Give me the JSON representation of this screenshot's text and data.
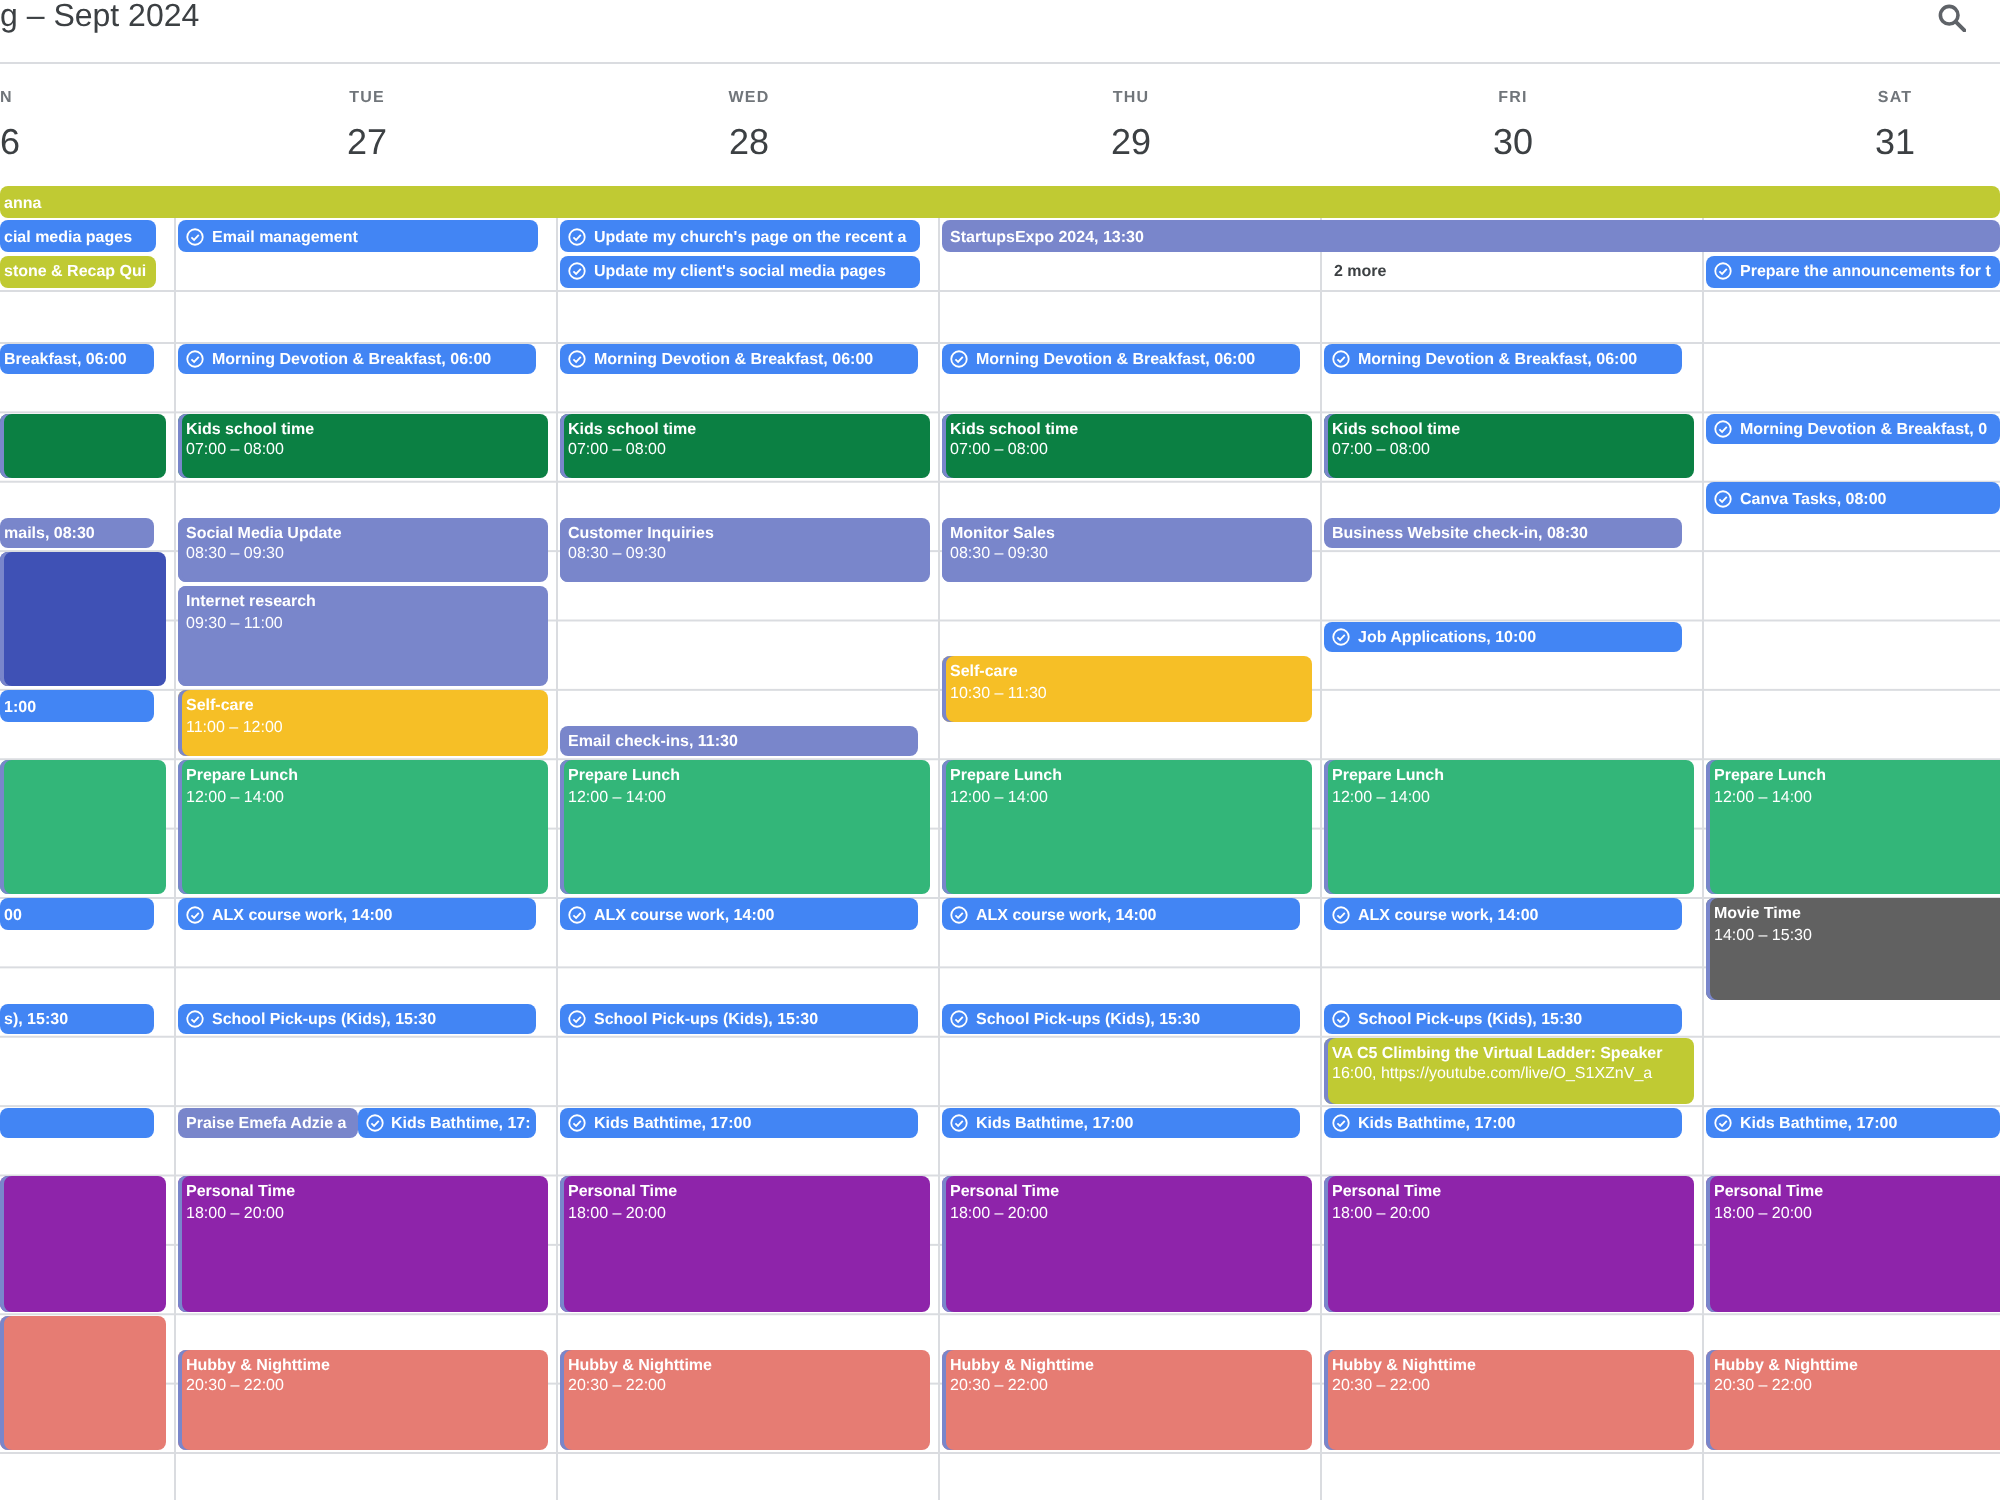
{
  "top_bar": {
    "title": "g – Sept 2024"
  },
  "day_headers": [
    {
      "name": "N",
      "date": "6"
    },
    {
      "name": "TUE",
      "date": "27"
    },
    {
      "name": "WED",
      "date": "28"
    },
    {
      "name": "THU",
      "date": "29"
    },
    {
      "name": "FRI",
      "date": "30"
    },
    {
      "name": "SAT",
      "date": "31"
    }
  ],
  "all_day_lanes": [
    [
      {
        "kind": "chip",
        "text": "anna",
        "color": "#c0ca33"
      },
      {
        "kind": "continued"
      },
      {
        "kind": "continued"
      },
      {
        "kind": "continued"
      },
      {
        "kind": "continued"
      },
      {
        "kind": "continued"
      }
    ],
    [
      {
        "kind": "chip",
        "text": "cial media pages",
        "color": "#4285f4"
      },
      {
        "kind": "task",
        "text": "Email management",
        "color": "#4285f4"
      },
      {
        "kind": "task",
        "text": "Update my church's page on the recent a",
        "color": "#4285f4"
      },
      {
        "kind": "chip",
        "text": "StartupsExpo 2024, 13:30",
        "color": "#7986cb"
      },
      {
        "kind": "continued"
      },
      {
        "kind": "continued"
      }
    ],
    [
      {
        "kind": "chip",
        "text": "stone & Recap Qui",
        "color": "#c0ca33"
      },
      {
        "kind": "empty"
      },
      {
        "kind": "task",
        "text": "Update my client's social media pages",
        "color": "#4285f4"
      },
      {
        "kind": "empty"
      },
      {
        "kind": "more",
        "text": "2 more"
      },
      {
        "kind": "task",
        "text": "Prepare the announcements for t",
        "color": "#4285f4"
      }
    ]
  ],
  "day_columns": [
    {
      "slots": [
        {
          "kind": "chip",
          "text": "Breakfast, 06:00",
          "color": "#4285f4"
        },
        {
          "kind": "empty"
        },
        {
          "kind": "block",
          "color": "#0b8043"
        },
        {
          "kind": "continued"
        },
        {
          "kind": "empty"
        },
        {
          "kind": "chip",
          "text": "mails, 08:30",
          "color": "#7986cb"
        },
        {
          "kind": "block",
          "color": "#3f51b5"
        },
        {
          "kind": "continued"
        },
        {
          "kind": "continued"
        },
        {
          "kind": "continued"
        },
        {
          "kind": "chip",
          "text": "1:00",
          "color": "#4285f4"
        },
        {
          "kind": "empty"
        },
        {
          "kind": "block",
          "color": "#33b679"
        },
        {
          "kind": "continued"
        },
        {
          "kind": "continued"
        },
        {
          "kind": "continued"
        },
        {
          "kind": "chip",
          "text": "00",
          "color": "#4285f4"
        },
        {
          "kind": "empty"
        },
        {
          "kind": "empty"
        },
        {
          "kind": "chip",
          "text": "s), 15:30",
          "color": "#4285f4"
        },
        {
          "kind": "empty"
        },
        {
          "kind": "empty"
        },
        {
          "kind": "chip",
          "color": "#4285f4"
        },
        {
          "kind": "empty"
        },
        {
          "kind": "block",
          "color": "#8e24aa"
        },
        {
          "kind": "continued"
        },
        {
          "kind": "continued"
        },
        {
          "kind": "continued"
        },
        {
          "kind": "block",
          "color": "#e67c73"
        },
        {
          "kind": "continued"
        },
        {
          "kind": "continued"
        },
        {
          "kind": "continued"
        }
      ]
    },
    {
      "slots": [
        {
          "kind": "task",
          "text": "Morning Devotion & Breakfast, 06:00",
          "color": "#4285f4"
        },
        {
          "kind": "empty"
        },
        {
          "kind": "block",
          "title": "Kids school time",
          "time": "07:00 – 08:00",
          "color": "#0b8043"
        },
        {
          "kind": "continued"
        },
        {
          "kind": "empty"
        },
        {
          "kind": "block",
          "title": "Social Media Update",
          "time": "08:30 – 09:30",
          "color": "#7986cb"
        },
        {
          "kind": "continued"
        },
        {
          "kind": "block",
          "title": "Internet research",
          "time": "09:30 – 11:00",
          "color": "#7986cb"
        },
        {
          "kind": "continued"
        },
        {
          "kind": "continued"
        },
        {
          "kind": "block",
          "title": "Self-care",
          "time": "11:00 – 12:00",
          "color": "#f6bf26"
        },
        {
          "kind": "continued"
        },
        {
          "kind": "block",
          "title": "Prepare Lunch",
          "time": "12:00 – 14:00",
          "color": "#33b679"
        },
        {
          "kind": "continued"
        },
        {
          "kind": "continued"
        },
        {
          "kind": "continued"
        },
        {
          "kind": "task",
          "text": "ALX course work, 14:00",
          "color": "#4285f4"
        },
        {
          "kind": "empty"
        },
        {
          "kind": "empty"
        },
        {
          "kind": "task",
          "text": "School Pick-ups (Kids), 15:30",
          "color": "#4285f4"
        },
        {
          "kind": "empty"
        },
        {
          "kind": "empty"
        },
        {
          "kind": "overlap",
          "events": [
            {
              "kind": "chip",
              "text": "Praise Emefa Adzie a",
              "color": "#7986cb"
            },
            {
              "kind": "task",
              "text": "Kids Bathtime, 17:",
              "color": "#4285f4"
            }
          ]
        },
        {
          "kind": "empty"
        },
        {
          "kind": "block",
          "title": "Personal Time",
          "time": "18:00 – 20:00",
          "color": "#8e24aa"
        },
        {
          "kind": "continued"
        },
        {
          "kind": "continued"
        },
        {
          "kind": "continued"
        },
        {
          "kind": "empty"
        },
        {
          "kind": "block",
          "title": "Hubby & Nighttime",
          "time": "20:30 – 22:00",
          "color": "#e67c73"
        },
        {
          "kind": "continued"
        },
        {
          "kind": "continued"
        }
      ]
    },
    {
      "slots": [
        {
          "kind": "task",
          "text": "Morning Devotion & Breakfast, 06:00",
          "color": "#4285f4"
        },
        {
          "kind": "empty"
        },
        {
          "kind": "block",
          "title": "Kids school time",
          "time": "07:00 – 08:00",
          "color": "#0b8043"
        },
        {
          "kind": "continued"
        },
        {
          "kind": "empty"
        },
        {
          "kind": "block",
          "title": "Customer Inquiries",
          "time": "08:30 – 09:30",
          "color": "#7986cb"
        },
        {
          "kind": "continued"
        },
        {
          "kind": "empty"
        },
        {
          "kind": "empty"
        },
        {
          "kind": "empty"
        },
        {
          "kind": "empty"
        },
        {
          "kind": "chip",
          "text": "Email check-ins, 11:30",
          "color": "#7986cb"
        },
        {
          "kind": "block",
          "title": "Prepare Lunch",
          "time": "12:00 – 14:00",
          "color": "#33b679"
        },
        {
          "kind": "continued"
        },
        {
          "kind": "continued"
        },
        {
          "kind": "continued"
        },
        {
          "kind": "task",
          "text": "ALX course work, 14:00",
          "color": "#4285f4"
        },
        {
          "kind": "empty"
        },
        {
          "kind": "empty"
        },
        {
          "kind": "task",
          "text": "School Pick-ups (Kids), 15:30",
          "color": "#4285f4"
        },
        {
          "kind": "empty"
        },
        {
          "kind": "empty"
        },
        {
          "kind": "task",
          "text": "Kids Bathtime, 17:00",
          "color": "#4285f4"
        },
        {
          "kind": "empty"
        },
        {
          "kind": "block",
          "title": "Personal Time",
          "time": "18:00 – 20:00",
          "color": "#8e24aa"
        },
        {
          "kind": "continued"
        },
        {
          "kind": "continued"
        },
        {
          "kind": "continued"
        },
        {
          "kind": "empty"
        },
        {
          "kind": "block",
          "title": "Hubby & Nighttime",
          "time": "20:30 – 22:00",
          "color": "#e67c73"
        },
        {
          "kind": "continued"
        },
        {
          "kind": "continued"
        }
      ]
    },
    {
      "slots": [
        {
          "kind": "task",
          "text": "Morning Devotion & Breakfast, 06:00",
          "color": "#4285f4"
        },
        {
          "kind": "empty"
        },
        {
          "kind": "block",
          "title": "Kids school time",
          "time": "07:00 – 08:00",
          "color": "#0b8043"
        },
        {
          "kind": "continued"
        },
        {
          "kind": "empty"
        },
        {
          "kind": "block",
          "title": "Monitor Sales",
          "time": "08:30 – 09:30",
          "color": "#7986cb"
        },
        {
          "kind": "continued"
        },
        {
          "kind": "empty"
        },
        {
          "kind": "empty"
        },
        {
          "kind": "block",
          "title": "Self-care",
          "time": "10:30 – 11:30",
          "color": "#f6bf26"
        },
        {
          "kind": "continued"
        },
        {
          "kind": "empty"
        },
        {
          "kind": "block",
          "title": "Prepare Lunch",
          "time": "12:00 – 14:00",
          "color": "#33b679"
        },
        {
          "kind": "continued"
        },
        {
          "kind": "continued"
        },
        {
          "kind": "continued"
        },
        {
          "kind": "task",
          "text": "ALX course work, 14:00",
          "color": "#4285f4"
        },
        {
          "kind": "empty"
        },
        {
          "kind": "empty"
        },
        {
          "kind": "task",
          "text": "School Pick-ups (Kids), 15:30",
          "color": "#4285f4"
        },
        {
          "kind": "empty"
        },
        {
          "kind": "empty"
        },
        {
          "kind": "task",
          "text": "Kids Bathtime, 17:00",
          "color": "#4285f4"
        },
        {
          "kind": "empty"
        },
        {
          "kind": "block",
          "title": "Personal Time",
          "time": "18:00 – 20:00",
          "color": "#8e24aa"
        },
        {
          "kind": "continued"
        },
        {
          "kind": "continued"
        },
        {
          "kind": "continued"
        },
        {
          "kind": "empty"
        },
        {
          "kind": "block",
          "title": "Hubby & Nighttime",
          "time": "20:30 – 22:00",
          "color": "#e67c73"
        },
        {
          "kind": "continued"
        },
        {
          "kind": "continued"
        }
      ]
    },
    {
      "slots": [
        {
          "kind": "task",
          "text": "Morning Devotion & Breakfast, 06:00",
          "color": "#4285f4"
        },
        {
          "kind": "empty"
        },
        {
          "kind": "block",
          "title": "Kids school time",
          "time": "07:00 – 08:00",
          "color": "#0b8043"
        },
        {
          "kind": "continued"
        },
        {
          "kind": "empty"
        },
        {
          "kind": "chip",
          "text": "Business Website check-in, 08:30",
          "color": "#7986cb"
        },
        {
          "kind": "empty"
        },
        {
          "kind": "empty"
        },
        {
          "kind": "task",
          "text": "Job Applications, 10:00",
          "color": "#4285f4"
        },
        {
          "kind": "empty"
        },
        {
          "kind": "empty"
        },
        {
          "kind": "empty"
        },
        {
          "kind": "block",
          "title": "Prepare Lunch",
          "time": "12:00 – 14:00",
          "color": "#33b679"
        },
        {
          "kind": "continued"
        },
        {
          "kind": "continued"
        },
        {
          "kind": "continued"
        },
        {
          "kind": "task",
          "text": "ALX course work, 14:00",
          "color": "#4285f4"
        },
        {
          "kind": "empty"
        },
        {
          "kind": "empty"
        },
        {
          "kind": "task",
          "text": "School Pick-ups (Kids), 15:30",
          "color": "#4285f4"
        },
        {
          "kind": "block",
          "title": "VA C5 Climbing the Virtual Ladder: Speaker",
          "time": "16:00, https://youtube.com/live/O_S1XZnV_a",
          "color": "#c0ca33"
        },
        {
          "kind": "continued"
        },
        {
          "kind": "task",
          "text": "Kids Bathtime, 17:00",
          "color": "#4285f4"
        },
        {
          "kind": "empty"
        },
        {
          "kind": "block",
          "title": "Personal Time",
          "time": "18:00 – 20:00",
          "color": "#8e24aa"
        },
        {
          "kind": "continued"
        },
        {
          "kind": "continued"
        },
        {
          "kind": "continued"
        },
        {
          "kind": "empty"
        },
        {
          "kind": "block",
          "title": "Hubby & Nighttime",
          "time": "20:30 – 22:00",
          "color": "#e67c73"
        },
        {
          "kind": "continued"
        },
        {
          "kind": "continued"
        }
      ]
    },
    {
      "slots": [
        {
          "kind": "empty"
        },
        {
          "kind": "empty"
        },
        {
          "kind": "task",
          "text": "Morning Devotion & Breakfast, 0",
          "color": "#4285f4"
        },
        {
          "kind": "empty"
        },
        {
          "kind": "task",
          "text": "Canva Tasks, 08:00",
          "color": "#4285f4"
        },
        {
          "kind": "empty"
        },
        {
          "kind": "empty"
        },
        {
          "kind": "empty"
        },
        {
          "kind": "empty"
        },
        {
          "kind": "empty"
        },
        {
          "kind": "empty"
        },
        {
          "kind": "empty"
        },
        {
          "kind": "block",
          "title": "Prepare Lunch",
          "time": "12:00 – 14:00",
          "color": "#33b679"
        },
        {
          "kind": "continued"
        },
        {
          "kind": "continued"
        },
        {
          "kind": "continued"
        },
        {
          "kind": "block",
          "title": "Movie Time",
          "time": "14:00 – 15:30",
          "color": "#616161"
        },
        {
          "kind": "continued"
        },
        {
          "kind": "continued"
        },
        {
          "kind": "empty"
        },
        {
          "kind": "empty"
        },
        {
          "kind": "empty"
        },
        {
          "kind": "task",
          "text": "Kids Bathtime, 17:00",
          "color": "#4285f4"
        },
        {
          "kind": "empty"
        },
        {
          "kind": "block",
          "title": "Personal Time",
          "time": "18:00 – 20:00",
          "color": "#8e24aa"
        },
        {
          "kind": "continued"
        },
        {
          "kind": "continued"
        },
        {
          "kind": "continued"
        },
        {
          "kind": "empty"
        },
        {
          "kind": "block",
          "title": "Hubby & Nighttime",
          "time": "20:30 – 22:00",
          "color": "#e67c73"
        },
        {
          "kind": "continued"
        },
        {
          "kind": "continued"
        }
      ]
    }
  ]
}
